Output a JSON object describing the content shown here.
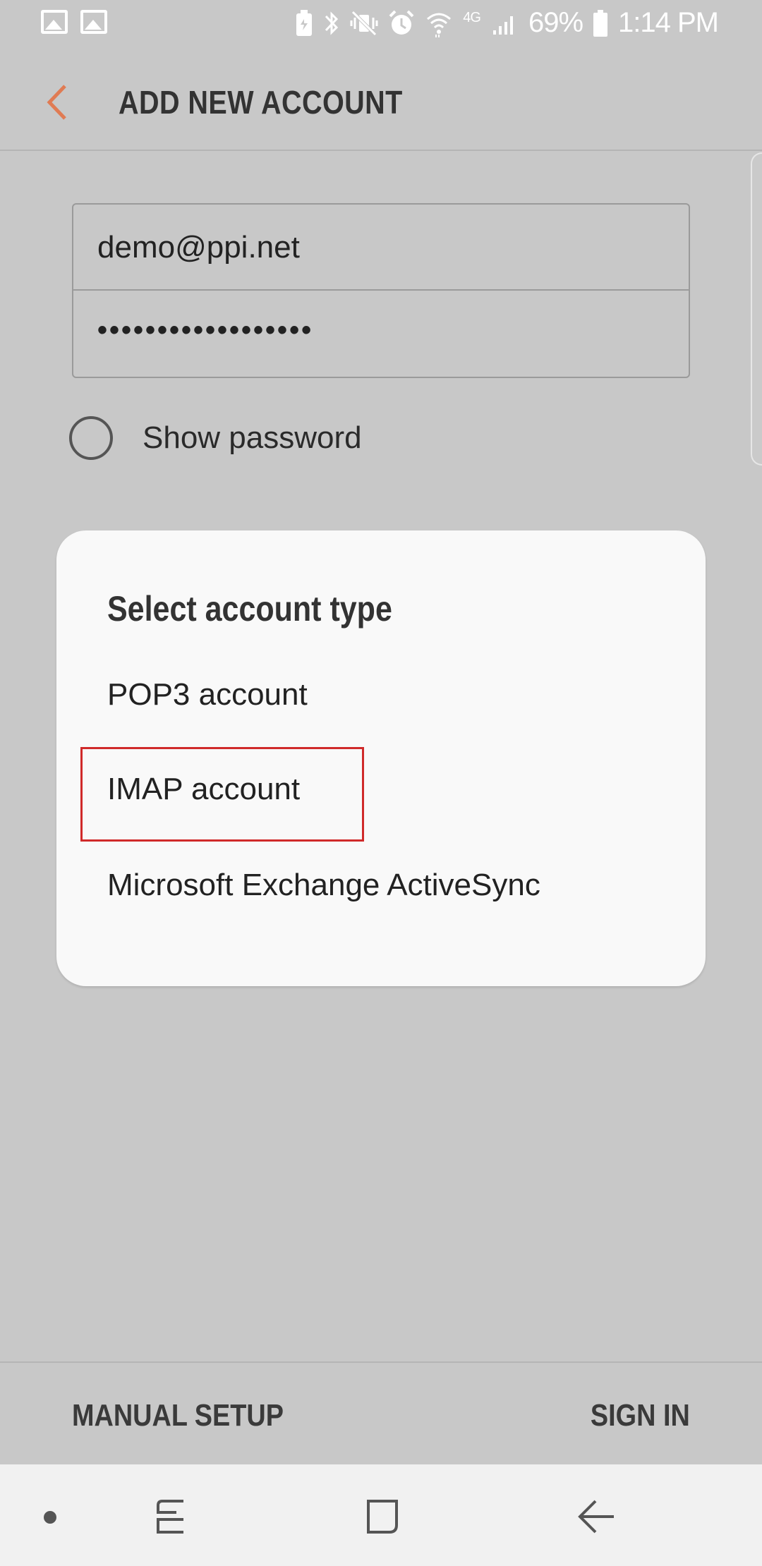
{
  "status_bar": {
    "battery_percent": "69%",
    "time": "1:14 PM",
    "network": "4G",
    "icons": [
      "image-icon",
      "image-icon",
      "battery-saver-icon",
      "bluetooth-icon",
      "vibrate-icon",
      "alarm-icon",
      "wifi-icon",
      "signal-icon",
      "battery-icon"
    ]
  },
  "app_bar": {
    "title": "ADD NEW ACCOUNT",
    "back_icon": "chevron-left-icon"
  },
  "form": {
    "email_value": "demo@ppi.net",
    "password_value": "••••••••••••••••••",
    "show_password_label": "Show password",
    "show_password_checked": false
  },
  "dialog": {
    "title": "Select account type",
    "options": [
      {
        "label": "POP3 account"
      },
      {
        "label": "IMAP account",
        "highlighted": true
      },
      {
        "label": "Microsoft Exchange ActiveSync"
      }
    ]
  },
  "actions": {
    "manual_setup": "MANUAL SETUP",
    "sign_in": "SIGN IN"
  },
  "nav_bar": {
    "icons": [
      "dot-icon",
      "recents-icon",
      "home-icon",
      "back-icon"
    ]
  },
  "colors": {
    "accent": "#e07b53",
    "highlight": "#d02a2a",
    "background": "#c8c8c8",
    "dialog": "#f9f9f9"
  }
}
